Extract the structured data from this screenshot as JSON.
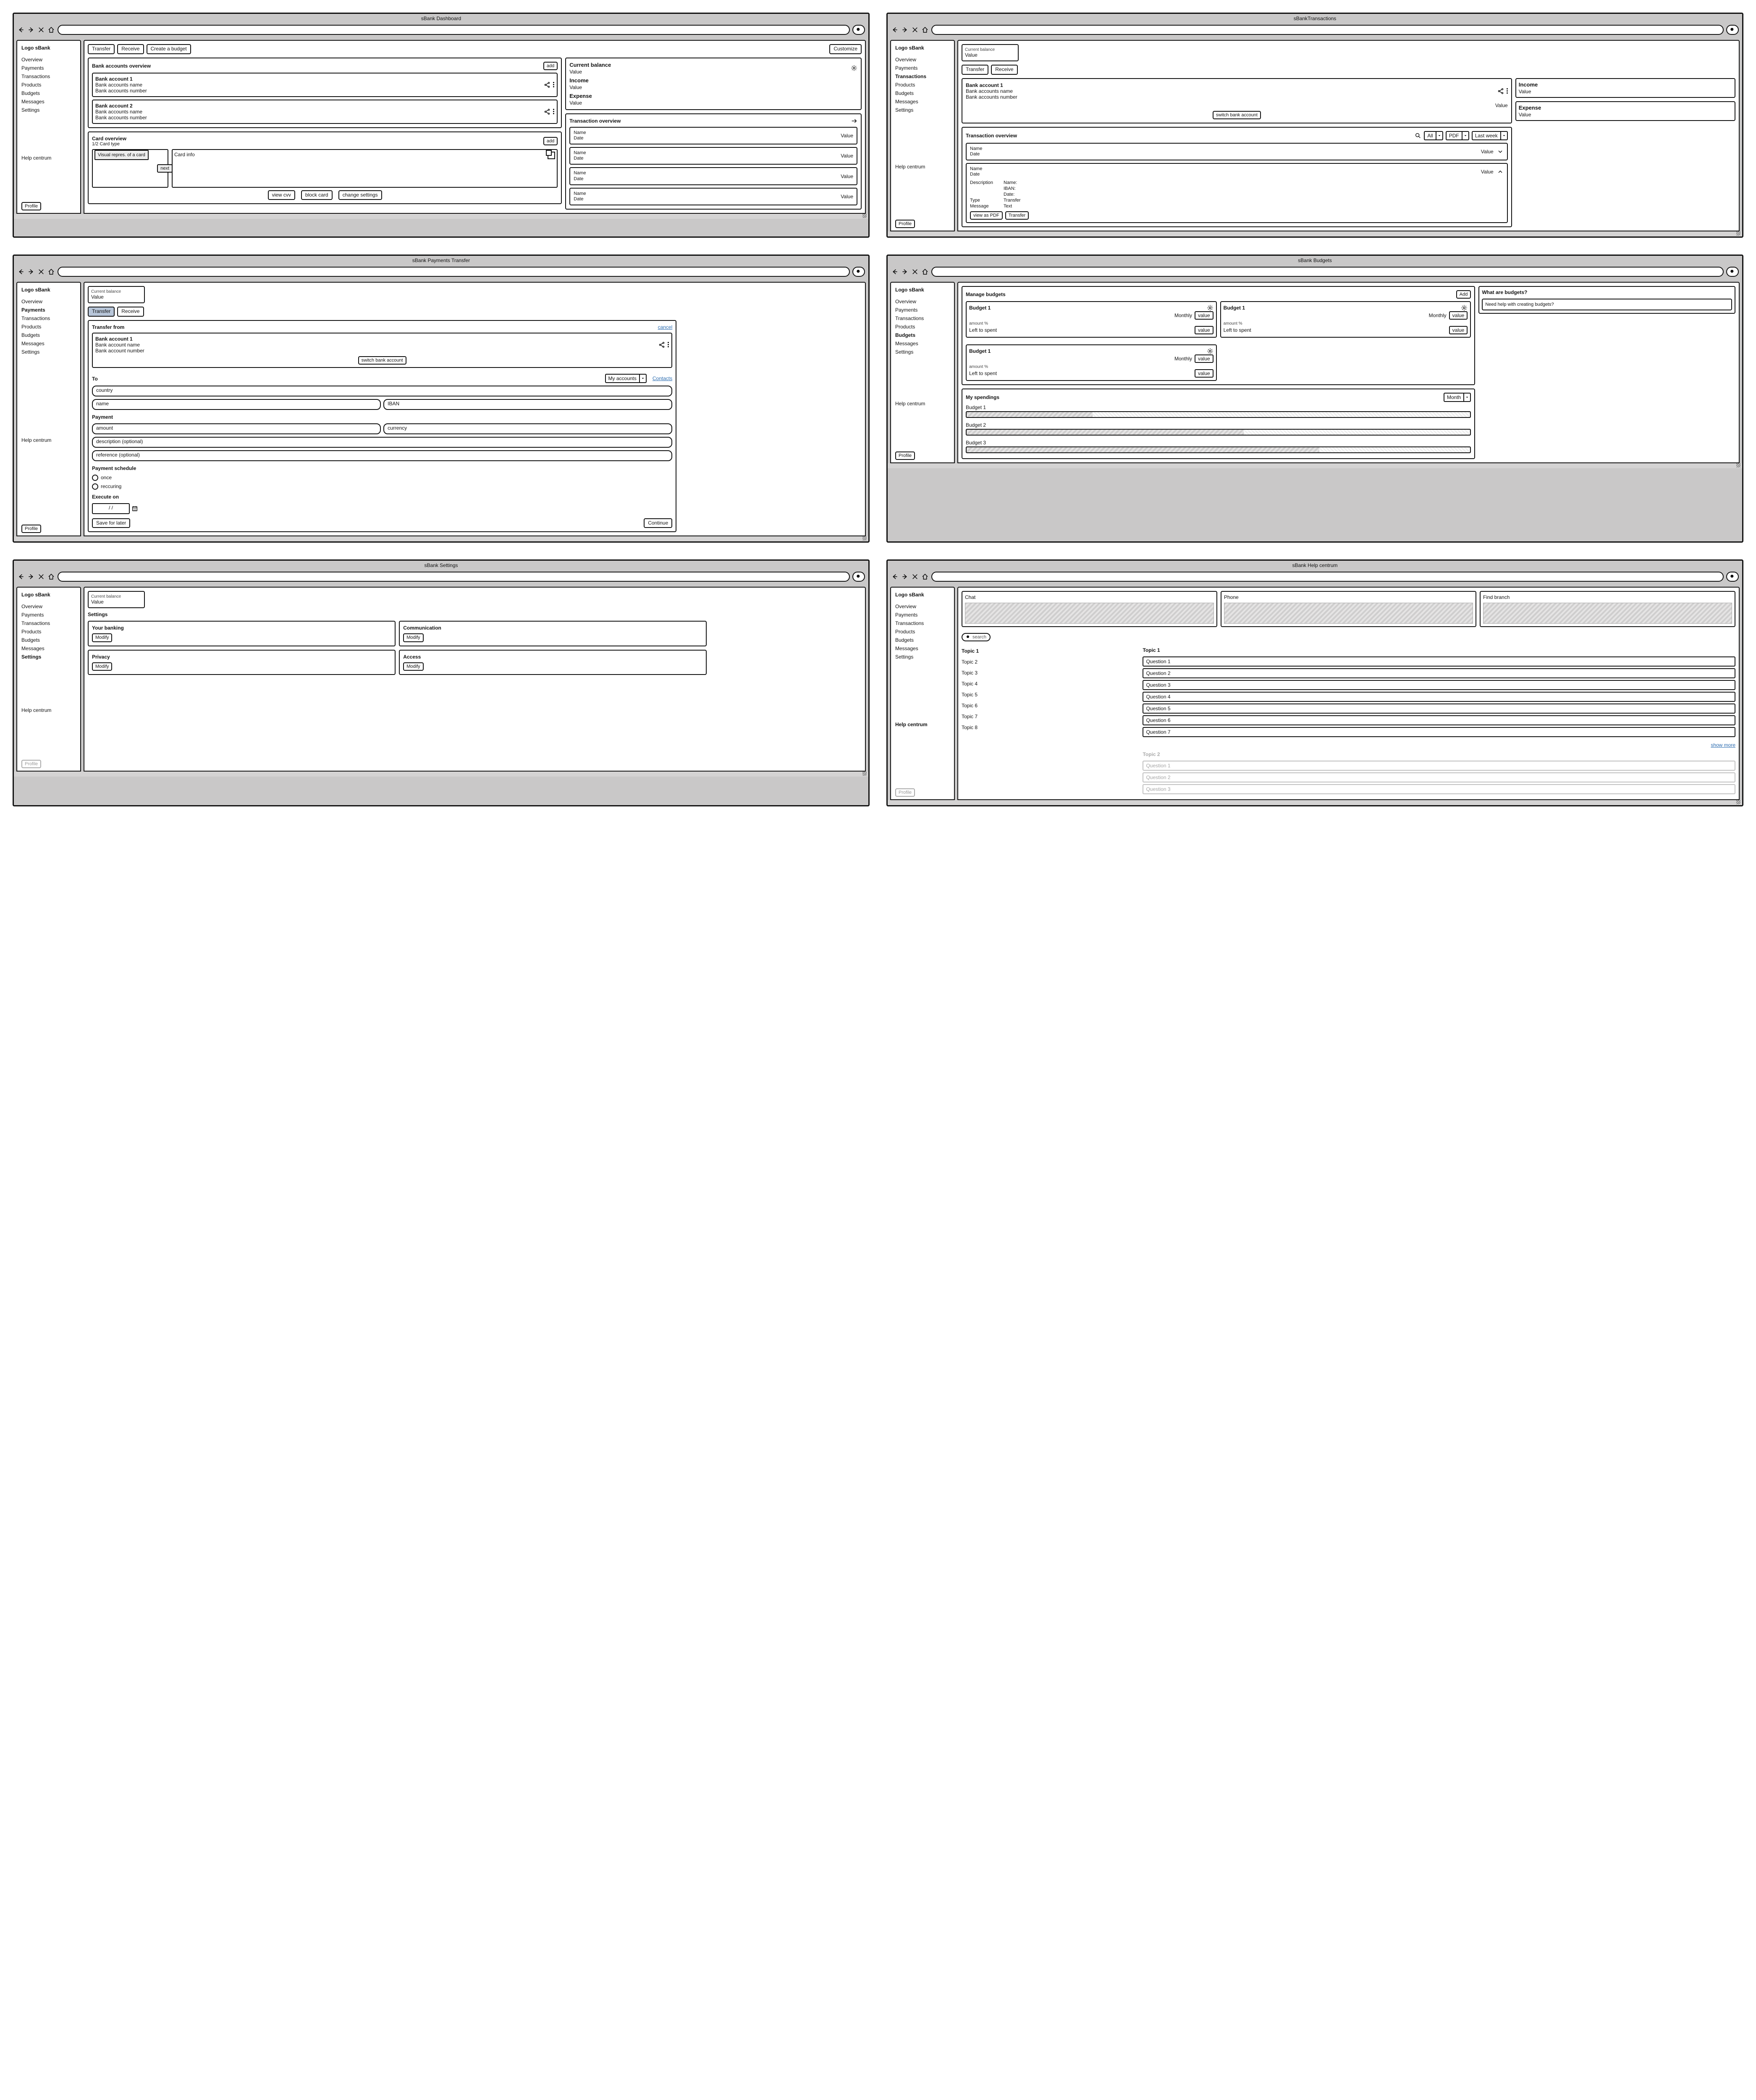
{
  "screens": {
    "dashboard": {
      "title": "sBank Dashboard",
      "logo": "Logo sBank",
      "sidebar": [
        "Overview",
        "Payments",
        "Transactions",
        "Products",
        "Budgets",
        "Messages",
        "Settings"
      ],
      "sidebar_active": "",
      "help": "Help centrum",
      "profile": "Profile",
      "actions": {
        "transfer": "Transfer",
        "receive": "Receive",
        "create_budget": "Create a budget",
        "customize": "Customize"
      },
      "accounts": {
        "header": "Bank accounts overview",
        "add": "add",
        "items": [
          {
            "title": "Bank account 1",
            "name": "Bank accounts name",
            "number": "Bank accounts number"
          },
          {
            "title": "Bank account 2",
            "name": "Bank accounts name",
            "number": "Bank accounts number"
          }
        ]
      },
      "card": {
        "header": "Card overview",
        "add": "add",
        "pager": "1/2   Card type",
        "repr": "Visual repres. of a card",
        "info": "Card info",
        "next": "next",
        "view_cvv": "view cvv",
        "block": "block card",
        "change": "change settings"
      },
      "balance": {
        "current": {
          "l": "Current balance",
          "v": "Value"
        },
        "income": {
          "l": "Income",
          "v": "Value"
        },
        "expense": {
          "l": "Expense",
          "v": "Value"
        }
      },
      "tx": {
        "header": "Transaction overview",
        "name": "Name",
        "date": "Date",
        "value": "Value"
      }
    },
    "transactions": {
      "title": "sBankTransactions",
      "current_balance_lbl": "Current balance",
      "current_balance_val": "Value",
      "transfer": "Transfer",
      "receive": "Receive",
      "account": {
        "title": "Bank account 1",
        "name": "Bank accounts name",
        "number": "Bank accounts number",
        "value": "Value",
        "switch": "switch bank account"
      },
      "side": {
        "income": {
          "l": "Income",
          "v": "Value"
        },
        "expense": {
          "l": "Expense",
          "v": "Value"
        }
      },
      "tx": {
        "header": "Transaction overview",
        "filter_all": "All",
        "filter_pdf": "PDF",
        "filter_last_week": "Last week",
        "name": "Name",
        "date": "Date",
        "value": "Value",
        "detail": {
          "desc": "Description",
          "name_k": "Name:",
          "iban_k": "IBAN:",
          "date_k": "Date:",
          "type_k": "Type",
          "type_v": "Transfer",
          "msg_k": "Message",
          "msg_v": "Text"
        },
        "view_pdf": "view as PDF",
        "transfer": "Transfer"
      }
    },
    "payments": {
      "title": "sBank Payments Transfer",
      "current_balance_lbl": "Current balance",
      "current_balance_val": "Value",
      "tabs": {
        "transfer": "Transfer",
        "receive": "Receive"
      },
      "from": {
        "header": "Transfer from",
        "cancel": "cancel",
        "account": {
          "title": "Bank account 1",
          "name": "Bank account name",
          "number": "Bank account number"
        },
        "switch": "switch bank account"
      },
      "to": {
        "header": "To",
        "mode": "My accounts",
        "contacts": "Contacts",
        "country": "country",
        "name": "name",
        "iban": "IBAN"
      },
      "payment": {
        "header": "Payment",
        "amount": "amount",
        "currency": "currency",
        "description": "description (optional)",
        "reference": "reference (optional)",
        "schedule": "Payment schedule",
        "once": "once",
        "recurring": "reccuring",
        "execute": "Execute on",
        "date_placeholder": "/   /",
        "save_later": "Save for later",
        "continue": "Continue"
      }
    },
    "budgets": {
      "title": "sBank Budgets",
      "manage": "Manage budgets",
      "add": "Add",
      "help_title": "What are budgets?",
      "help_text": "Need help with creating budgets?",
      "budget": {
        "name": "Budget 1",
        "period": "Monthly",
        "value": "value",
        "amount_pct": "amount %",
        "left": "Left to spent"
      },
      "spendings": {
        "header": "My spendings",
        "period": "Month",
        "items": [
          "Budget 1",
          "Budget 2",
          "Budget 3"
        ],
        "fills": [
          25,
          55,
          70
        ]
      }
    },
    "settings": {
      "title": "sBank Settings",
      "current_balance_lbl": "Current balance",
      "current_balance_val": "Value",
      "header": "Settings",
      "cards": {
        "banking": {
          "t": "Your banking",
          "b": "Modify"
        },
        "comm": {
          "t": "Communication",
          "b": "Modify"
        },
        "privacy": {
          "t": "Privacy",
          "b": "Modify"
        },
        "access": {
          "t": "Access",
          "b": "Modify"
        }
      }
    },
    "help": {
      "title": "sBank Help centrum",
      "contacts": {
        "chat": "Chat",
        "phone": "Phone",
        "branch": "Find branch"
      },
      "search": "search",
      "topics": [
        "Topic 1",
        "Topic 2",
        "Topic 3",
        "Topic 4",
        "Topic 5",
        "Topic 6",
        "Topic 7",
        "Topic 8"
      ],
      "faq_title": "Topic 1",
      "faq": [
        "Question 1",
        "Question 2",
        "Question 3",
        "Question 4",
        "Question 5",
        "Question 6",
        "Question 7"
      ],
      "show_more": "show more",
      "faq2_title": "Topic 2",
      "faq2": [
        "Question 1",
        "Question 2",
        "Question 3"
      ]
    }
  }
}
